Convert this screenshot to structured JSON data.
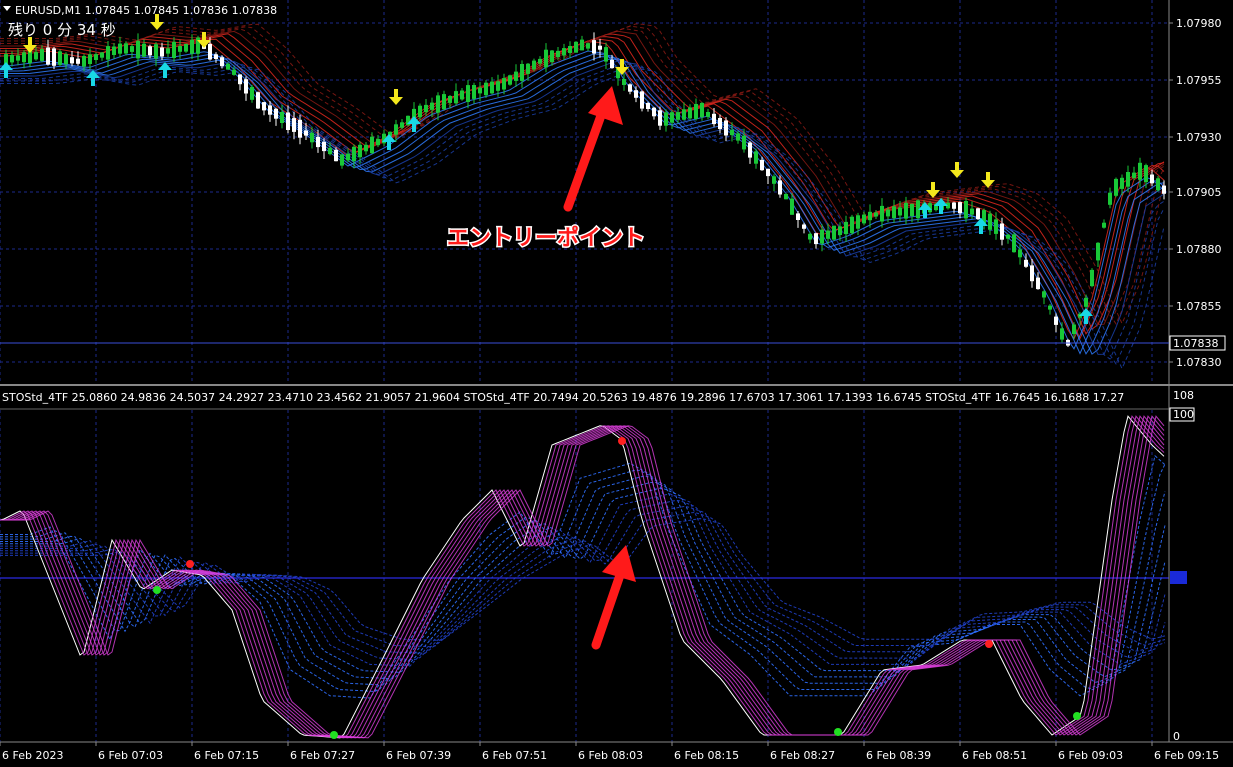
{
  "window": {
    "symbol_line": "EURUSD,M1  1.07845 1.07845 1.07836 1.07838",
    "countdown": "残り 0 分 34 秒"
  },
  "price_axis": {
    "ticks": [
      "1.07980",
      "1.07955",
      "1.07930",
      "1.07905",
      "1.07880",
      "1.07855",
      "1.07830"
    ],
    "current_price": "1.07838"
  },
  "annotation": {
    "entry_label": "エントリーポイント"
  },
  "indicator": {
    "header": "STOStd_4TF 25.0860 24.9836 24.5037 24.2927 23.4710 23.4562 21.9057 21.9604   STOStd_4TF 20.7494 20.5263 19.4876 19.2896 17.6703 17.3061 17.1393 16.6745   STOStd_4TF 16.7645 16.1688 17.27",
    "scale_top": "108",
    "scale_100": "100",
    "scale_50": "50",
    "scale_0": "0"
  },
  "time_axis": {
    "labels": [
      "6 Feb 2023",
      "6 Feb 07:03",
      "6 Feb 07:15",
      "6 Feb 07:27",
      "6 Feb 07:39",
      "6 Feb 07:51",
      "6 Feb 08:03",
      "6 Feb 08:15",
      "6 Feb 08:27",
      "6 Feb 08:39",
      "6 Feb 08:51",
      "6 Feb 09:03",
      "6 Feb 09:15"
    ]
  },
  "colors": {
    "background": "#000000",
    "grid": "#1c2a8c",
    "bull": "#19c837",
    "bear": "#ffffff",
    "red_ribbon": "#e0281e",
    "blue_ribbon": "#2f7dff",
    "magenta": "#e040e0",
    "arrow_yellow": "#f4e81c",
    "arrow_cyan": "#19d8e6",
    "annotation_red": "#ff1a1a"
  }
}
